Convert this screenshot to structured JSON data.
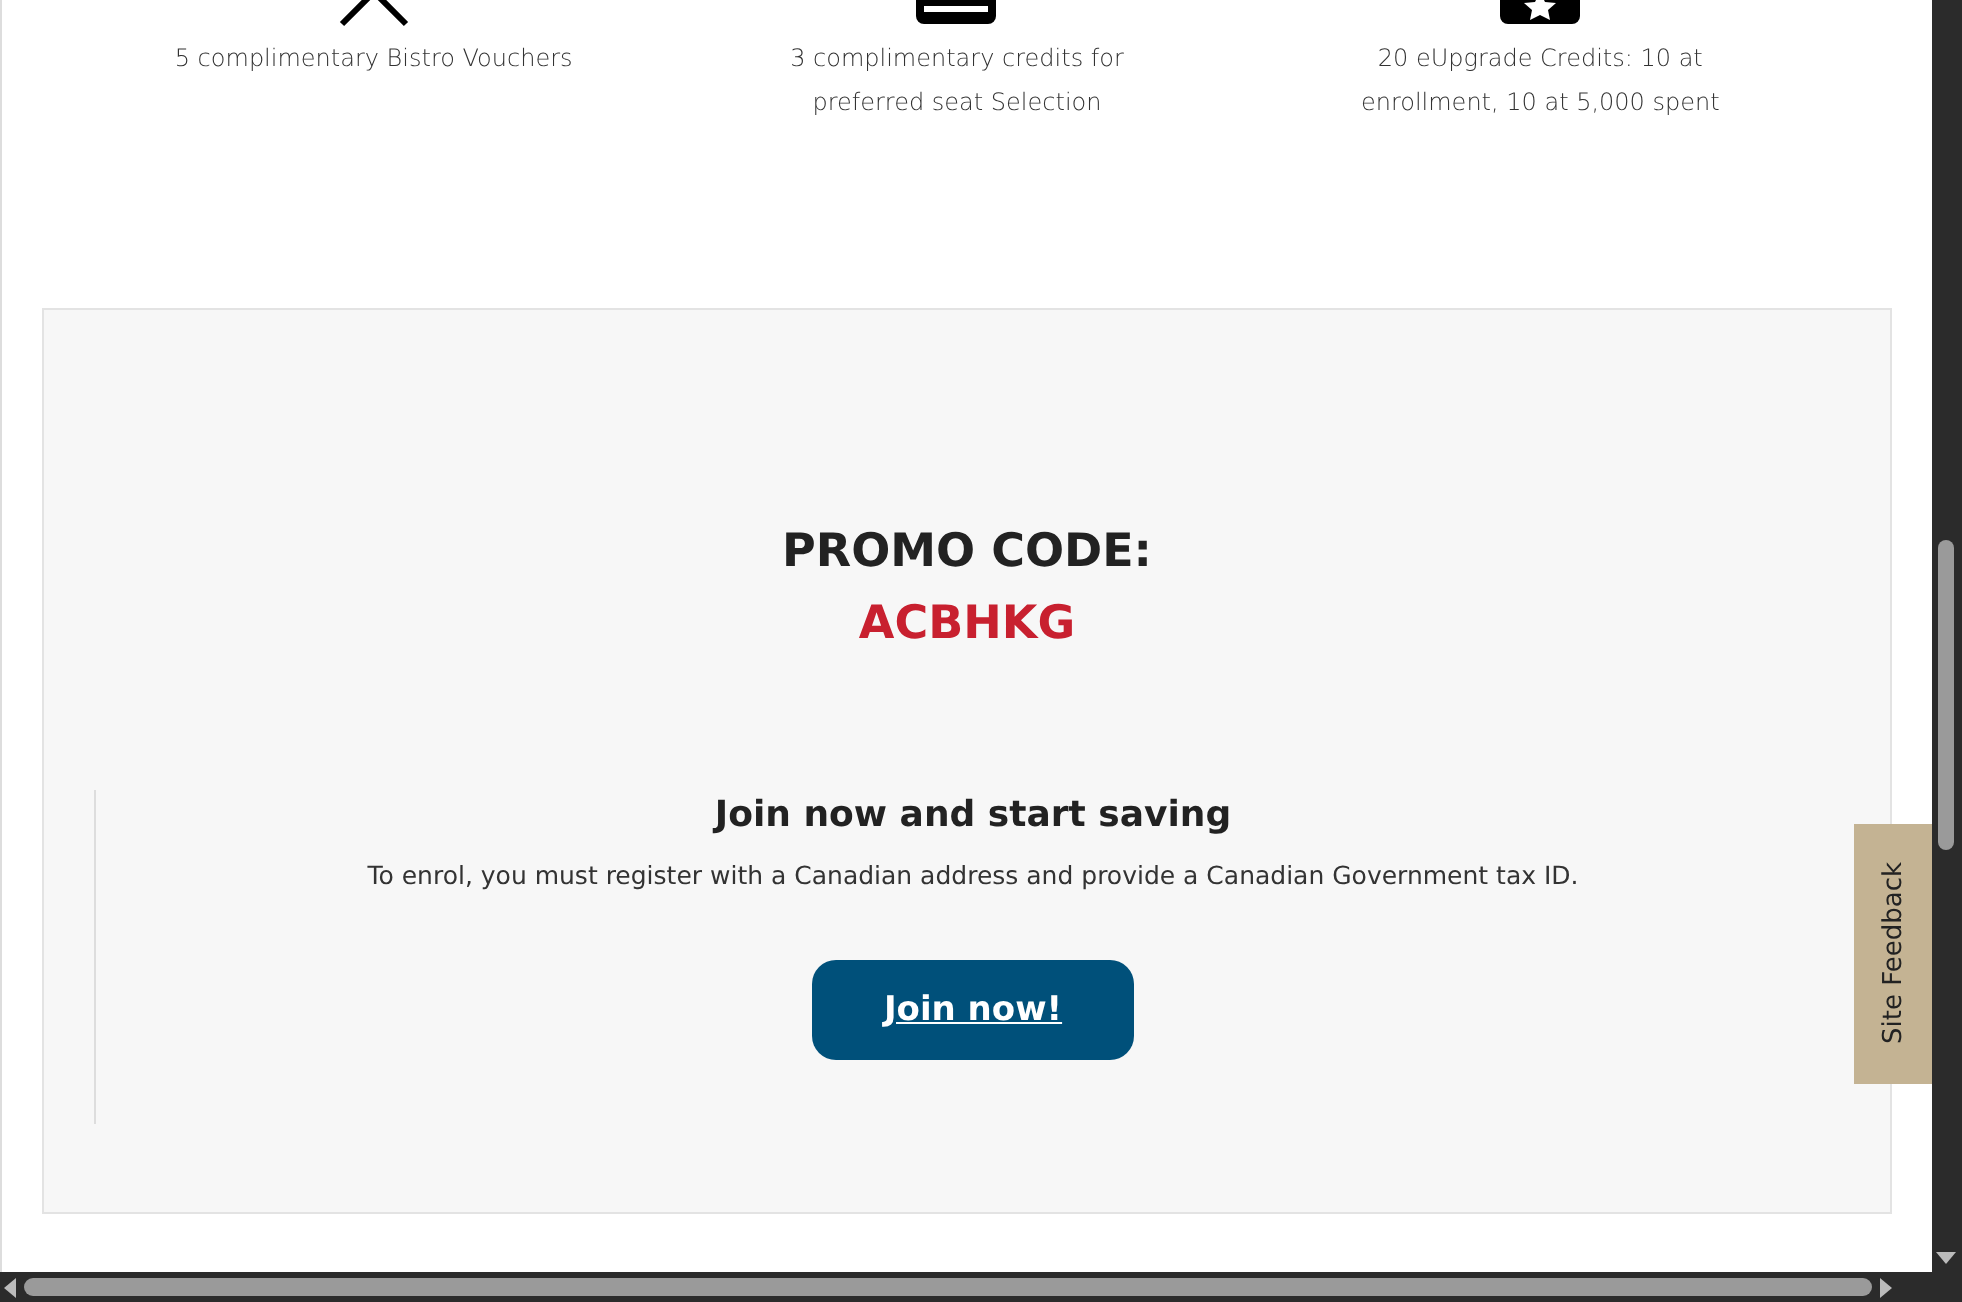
{
  "benefits": [
    {
      "kind": "cross",
      "text": "5 complimentary Bistro Vouchers"
    },
    {
      "kind": "seat",
      "text": "3 complimentary credits for preferred seat Selection"
    },
    {
      "kind": "star",
      "text": "20 eUpgrade Credits: 10 at enrollment, 10 at 5,000 spent"
    }
  ],
  "promo": {
    "label": "PROMO CODE:",
    "code": "ACBHKG"
  },
  "join": {
    "heading": "Join now and start saving",
    "text": "To enrol, you must register with a Canadian address and provide a Canadian Government tax ID.",
    "button": "Join now!"
  },
  "feedback_tab": "Site Feedback"
}
